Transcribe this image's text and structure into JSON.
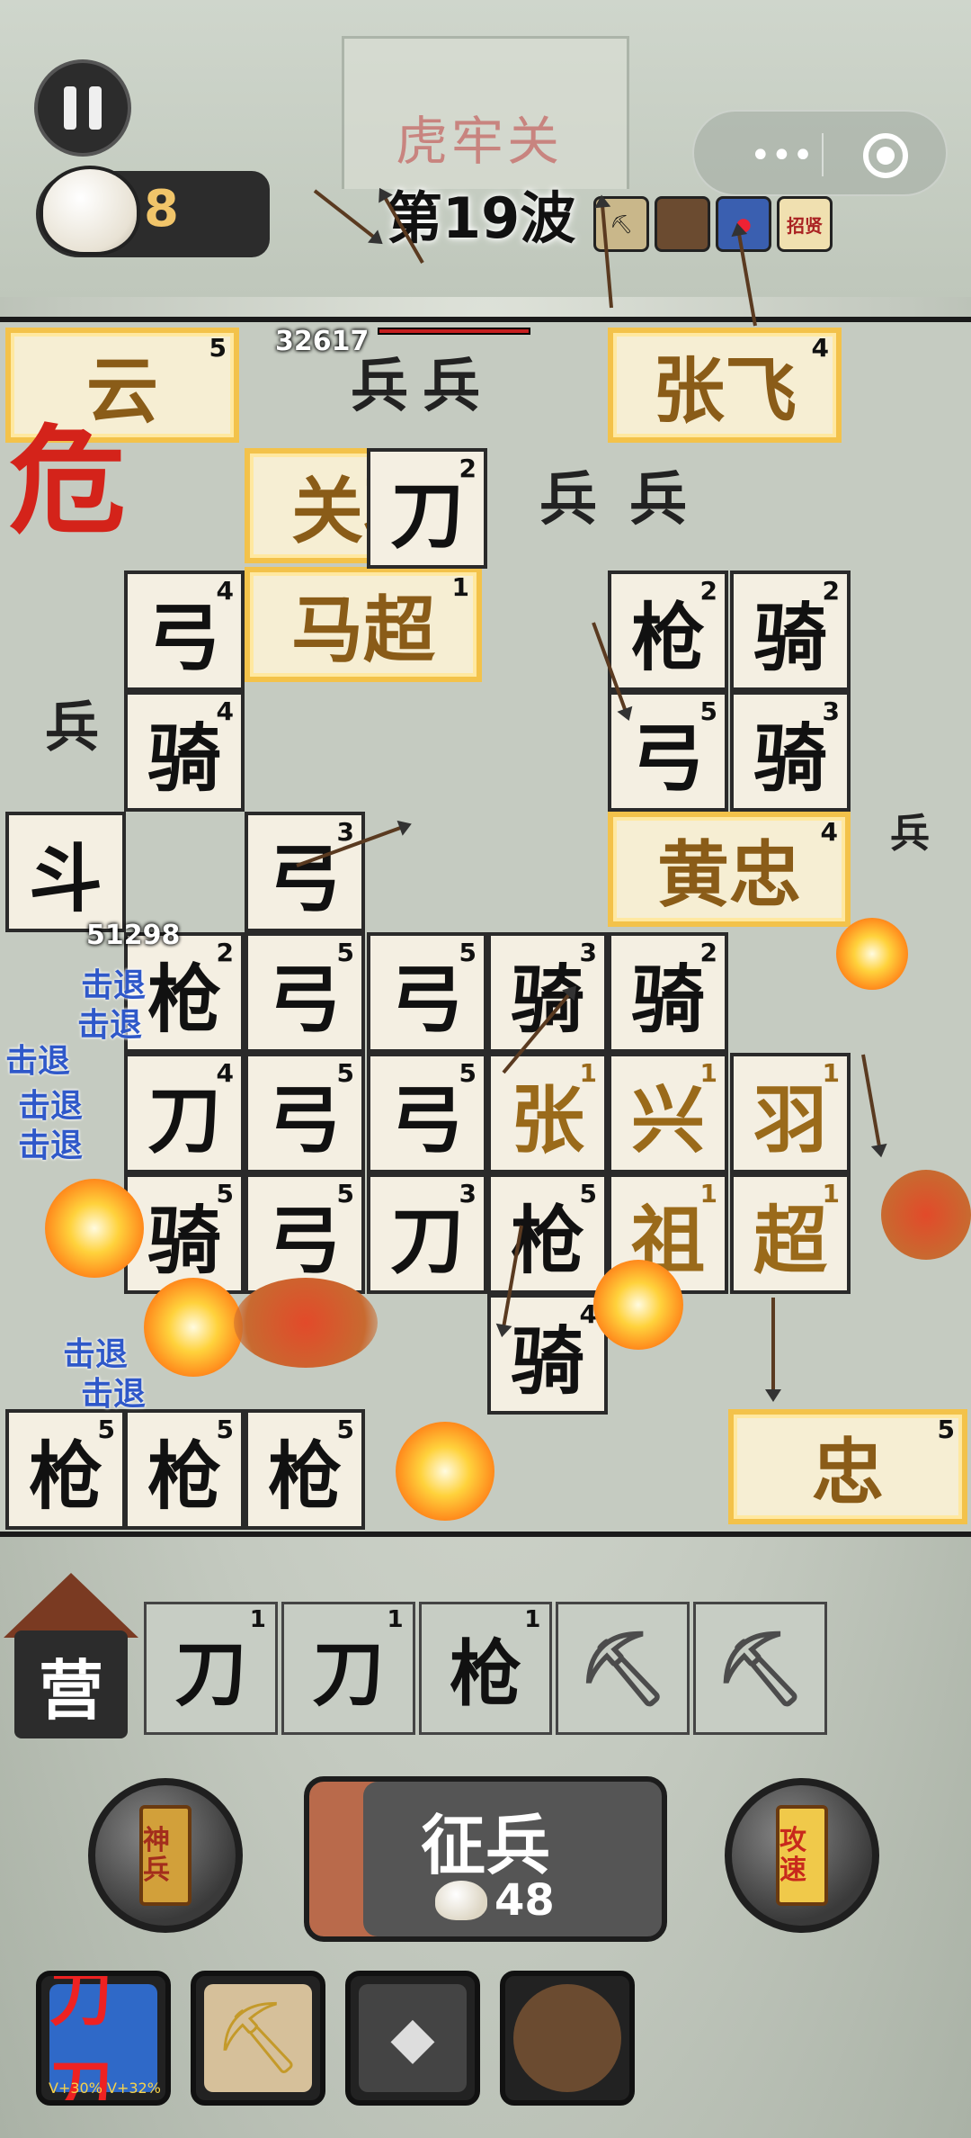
{
  "header": {
    "gate_title": "虎牢关",
    "coin_count": "8",
    "wave": "第19波"
  },
  "top_tools": {
    "tag_label": "招贤"
  },
  "board": {
    "danger": "危",
    "hp_numbers": [
      "32617",
      "51298"
    ],
    "knockback_text": "击退",
    "enemy_label": "兵",
    "hero_cards": [
      {
        "name": "云",
        "level": "5"
      },
      {
        "name": "张飞",
        "level": "4"
      },
      {
        "name": "关羽",
        "level": "4"
      },
      {
        "name": "马超",
        "level": "1"
      },
      {
        "name": "黄忠",
        "level": "4"
      },
      {
        "name": "忠",
        "level": "5"
      }
    ],
    "units": [
      {
        "glyph": "刀",
        "level": "2"
      },
      {
        "glyph": "弓",
        "level": "4"
      },
      {
        "glyph": "枪",
        "level": "2"
      },
      {
        "glyph": "骑",
        "level": "2"
      },
      {
        "glyph": "骑",
        "level": "4"
      },
      {
        "glyph": "弓",
        "level": "5"
      },
      {
        "glyph": "骑",
        "level": "3"
      },
      {
        "glyph": "斗",
        "level": ""
      },
      {
        "glyph": "弓",
        "level": "3"
      },
      {
        "glyph": "枪",
        "level": "2"
      },
      {
        "glyph": "弓",
        "level": "5"
      },
      {
        "glyph": "弓",
        "level": "5"
      },
      {
        "glyph": "骑",
        "level": "3"
      },
      {
        "glyph": "骑",
        "level": "2"
      },
      {
        "glyph": "刀",
        "level": "4"
      },
      {
        "glyph": "弓",
        "level": "5"
      },
      {
        "glyph": "弓",
        "level": "5"
      },
      {
        "glyph": "张",
        "level": "1"
      },
      {
        "glyph": "兴",
        "level": "1"
      },
      {
        "glyph": "羽",
        "level": "1"
      },
      {
        "glyph": "骑",
        "level": "5"
      },
      {
        "glyph": "弓",
        "level": "5"
      },
      {
        "glyph": "刀",
        "level": "3"
      },
      {
        "glyph": "枪",
        "level": "5"
      },
      {
        "glyph": "祖",
        "level": "1"
      },
      {
        "glyph": "超",
        "level": "1"
      },
      {
        "glyph": "骑",
        "level": "4"
      },
      {
        "glyph": "枪",
        "level": "5"
      },
      {
        "glyph": "枪",
        "level": "5"
      },
      {
        "glyph": "枪",
        "level": "5"
      }
    ]
  },
  "camp_label": "营",
  "bench": [
    {
      "glyph": "刀",
      "level": "1"
    },
    {
      "glyph": "刀",
      "level": "1"
    },
    {
      "glyph": "枪",
      "level": "1"
    },
    {
      "glyph": "shovel",
      "level": ""
    },
    {
      "glyph": "shovel",
      "level": ""
    }
  ],
  "controls": {
    "hero_scroll": "神兵",
    "recruit_label": "征兵",
    "recruit_cost": "48",
    "speed_scroll": "攻速"
  },
  "skills": {
    "dao_label": "刀刀",
    "dao_stat": "V+30% V+32%"
  },
  "colors": {
    "gold_border": "#f3c24a",
    "danger_red": "#d4231a",
    "knockback_blue": "#2f58c9",
    "coin_yellow": "#f1c56a"
  }
}
